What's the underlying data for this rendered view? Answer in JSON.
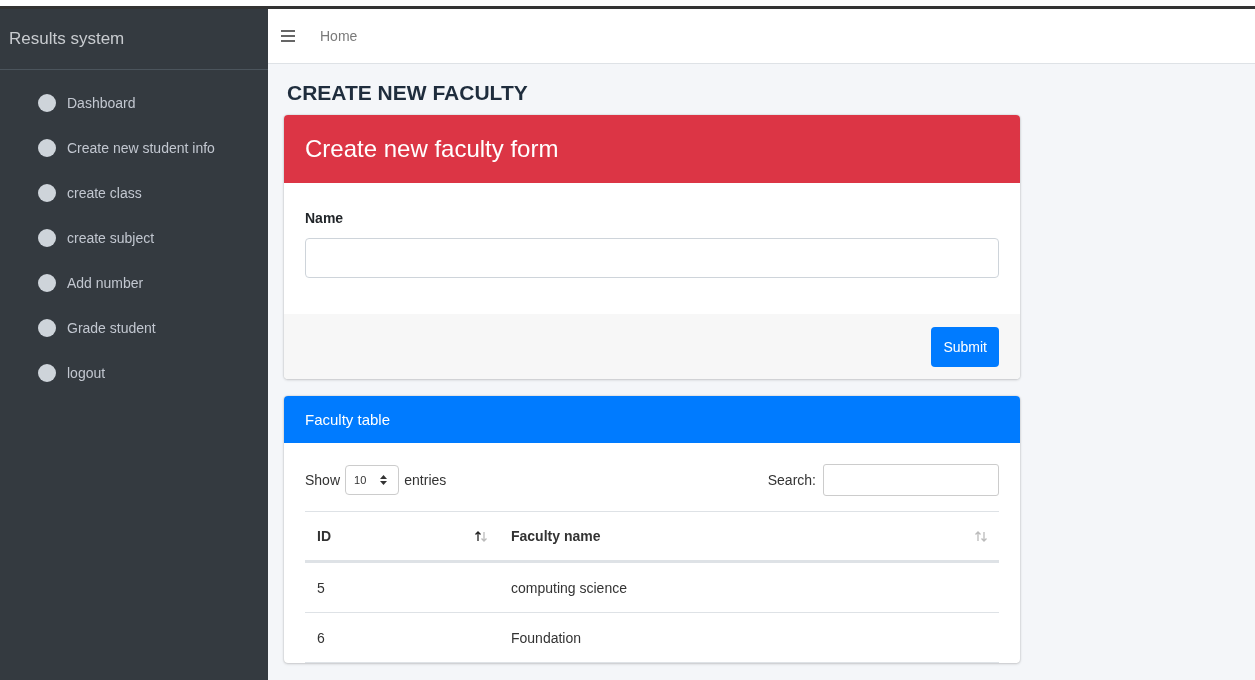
{
  "sidebar": {
    "brand": "Results system",
    "items": [
      {
        "label": "Dashboard"
      },
      {
        "label": "Create new student info"
      },
      {
        "label": "create class"
      },
      {
        "label": "create subject"
      },
      {
        "label": "Add number"
      },
      {
        "label": "Grade student"
      },
      {
        "label": "logout"
      }
    ]
  },
  "topbar": {
    "breadcrumb": "Home"
  },
  "page_title": "CREATE NEW FACULTY",
  "form_card": {
    "title": "Create new faculty form",
    "field_label": "Name",
    "submit": "Submit"
  },
  "table_card": {
    "title": "Faculty table",
    "show_label": "Show",
    "page_size": "10",
    "entries_label": "entries",
    "search_label": "Search:",
    "columns": [
      {
        "label": "ID",
        "sorted_ascending": true
      },
      {
        "label": "Faculty name",
        "sorted_ascending": false
      }
    ],
    "rows": [
      [
        "5",
        "computing science"
      ],
      [
        "6",
        "Foundation"
      ]
    ]
  }
}
